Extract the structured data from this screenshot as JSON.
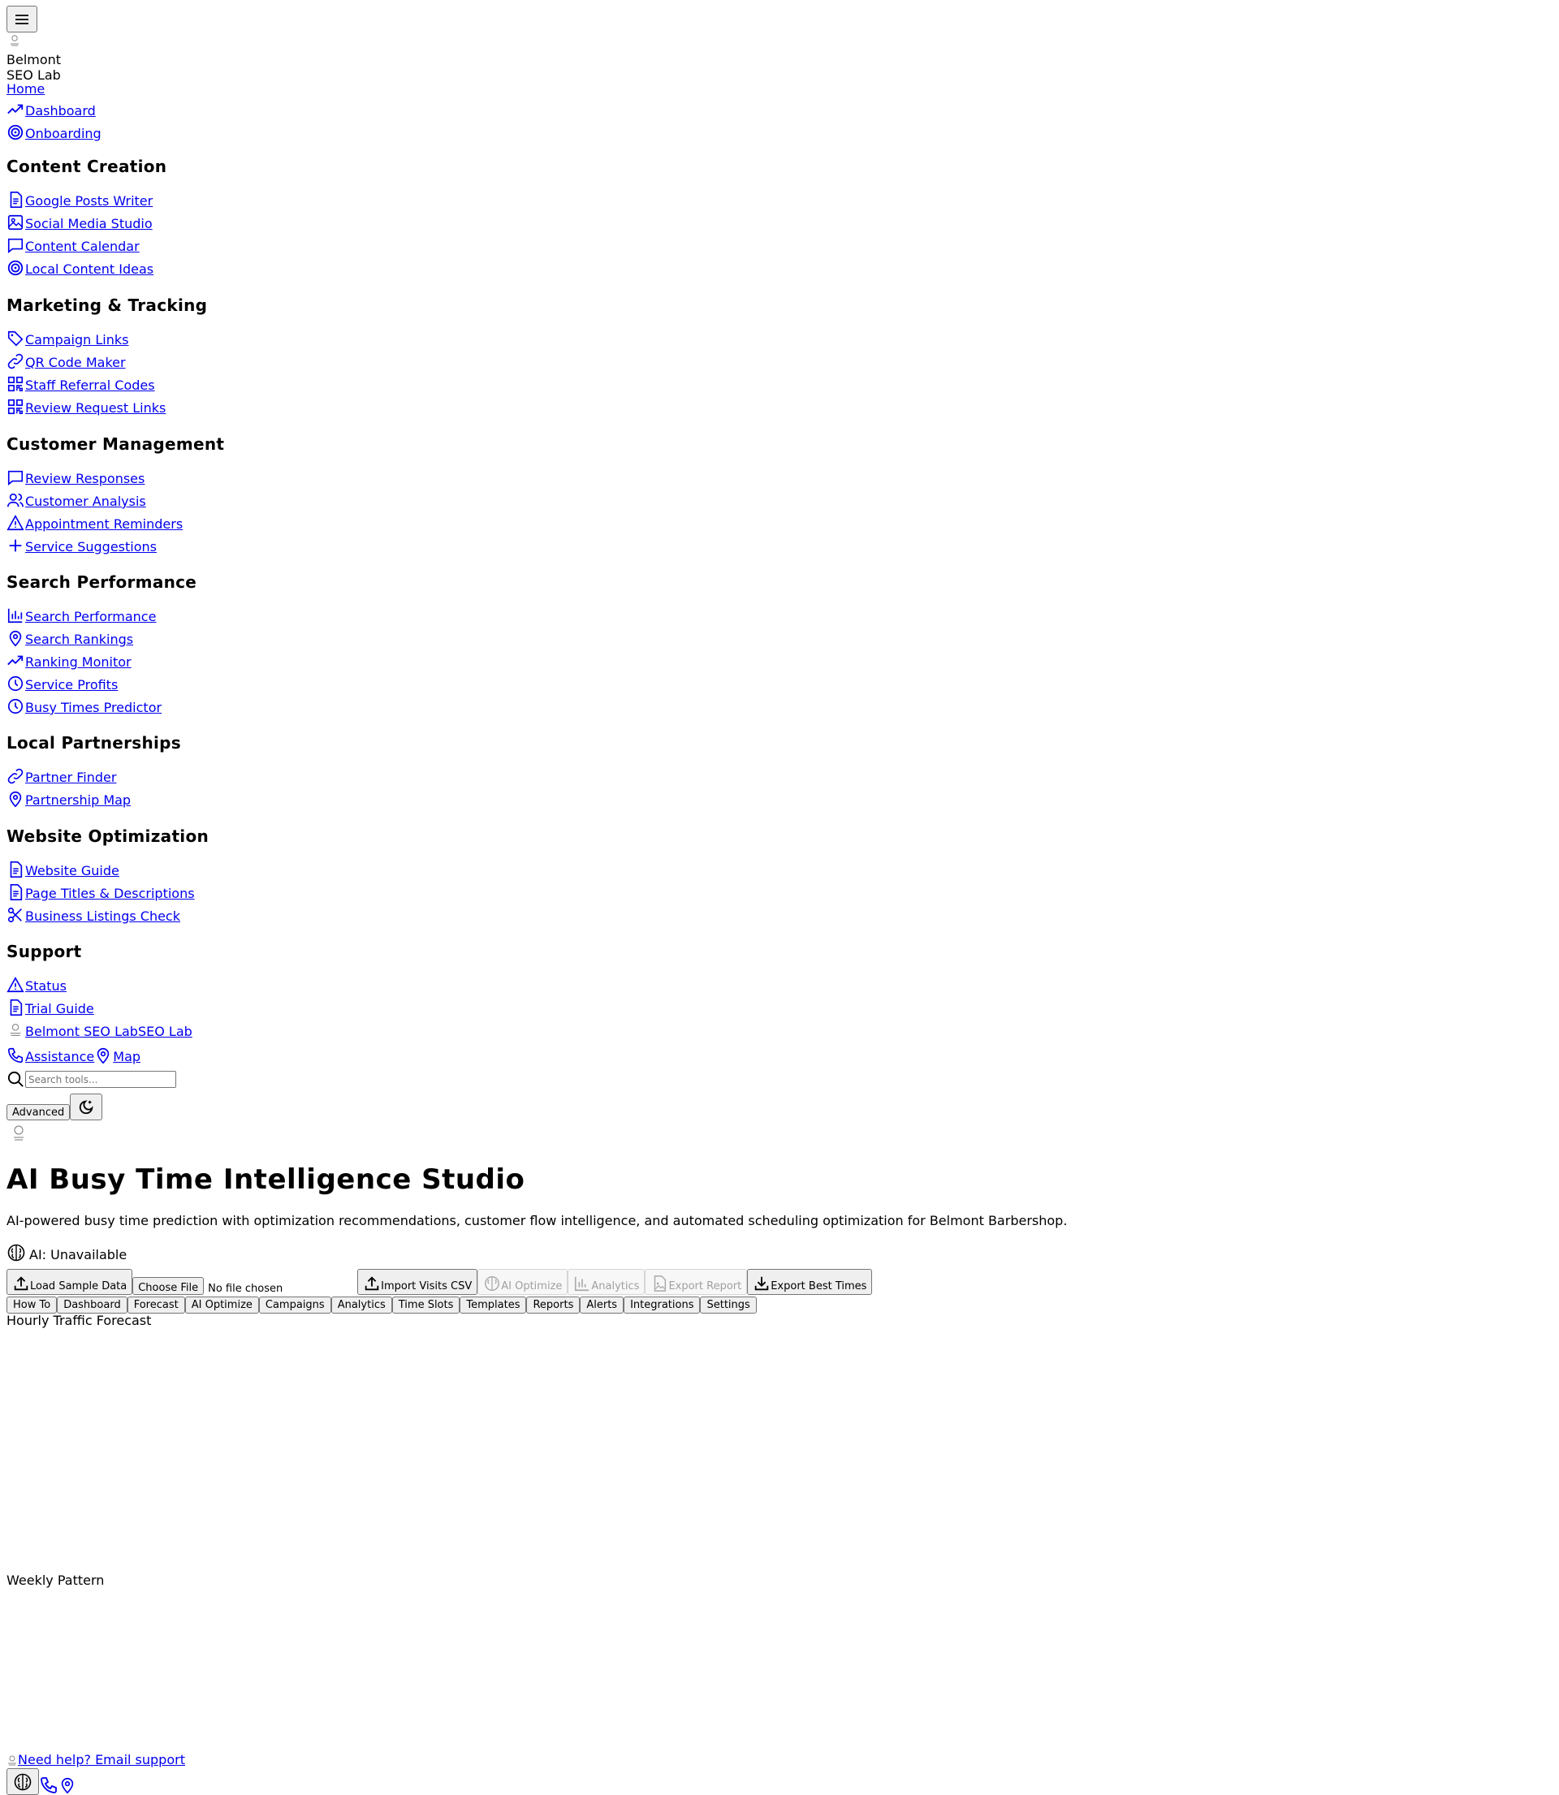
{
  "brand": {
    "name_line1": "Belmont",
    "name_line2": "SEO Lab"
  },
  "nav_top": [
    {
      "label": "Home",
      "icon": "none"
    },
    {
      "label": "Dashboard",
      "icon": "trending-up-icon"
    },
    {
      "label": "Onboarding",
      "icon": "target-icon"
    }
  ],
  "sections": [
    {
      "title": "Content Creation",
      "items": [
        {
          "label": "Google Posts Writer",
          "icon": "file-text-icon"
        },
        {
          "label": "Social Media Studio",
          "icon": "image-icon"
        },
        {
          "label": "Content Calendar",
          "icon": "message-square-icon"
        },
        {
          "label": "Local Content Ideas",
          "icon": "target-icon"
        }
      ]
    },
    {
      "title": "Marketing & Tracking",
      "items": [
        {
          "label": "Campaign Links",
          "icon": "tag-icon"
        },
        {
          "label": "QR Code Maker",
          "icon": "link-icon"
        },
        {
          "label": "Staff Referral Codes",
          "icon": "qr-code-icon"
        },
        {
          "label": "Review Request Links",
          "icon": "qr-code-icon"
        }
      ]
    },
    {
      "title": "Customer Management",
      "items": [
        {
          "label": "Review Responses",
          "icon": "message-square-icon"
        },
        {
          "label": "Customer Analysis",
          "icon": "users-icon"
        },
        {
          "label": "Appointment Reminders",
          "icon": "alert-triangle-icon"
        },
        {
          "label": "Service Suggestions",
          "icon": "plus-icon"
        }
      ]
    },
    {
      "title": "Search Performance",
      "items": [
        {
          "label": "Search Performance",
          "icon": "bar-chart-icon"
        },
        {
          "label": "Search Rankings",
          "icon": "map-pin-icon"
        },
        {
          "label": "Ranking Monitor",
          "icon": "trending-up-icon"
        },
        {
          "label": "Service Profits",
          "icon": "clock-icon"
        },
        {
          "label": "Busy Times Predictor",
          "icon": "clock-icon"
        }
      ]
    },
    {
      "title": "Local Partnerships",
      "items": [
        {
          "label": "Partner Finder",
          "icon": "link-icon"
        },
        {
          "label": "Partnership Map",
          "icon": "map-pin-icon"
        }
      ]
    },
    {
      "title": "Website Optimization",
      "items": [
        {
          "label": "Website Guide",
          "icon": "file-text-icon"
        },
        {
          "label": "Page Titles & Descriptions",
          "icon": "file-text-icon"
        },
        {
          "label": "Business Listings Check",
          "icon": "scissors-icon"
        }
      ]
    },
    {
      "title": "Support",
      "items": [
        {
          "label": "Status",
          "icon": "alert-triangle-icon"
        },
        {
          "label": "Trial Guide",
          "icon": "file-text-icon"
        },
        {
          "label": "Belmont SEO LabSEO Lab",
          "icon": "logo-icon"
        }
      ]
    }
  ],
  "support_extra": {
    "assistance": "Assistance",
    "map": "Map"
  },
  "search": {
    "placeholder": "Search tools..."
  },
  "advanced_label": "Advanced",
  "page": {
    "title": "AI Busy Time Intelligence Studio",
    "subtitle": "AI-powered busy time prediction with optimization recommendations, customer flow intelligence, and automated scheduling optimization for Belmont Barbershop.",
    "ai_status": "AI: Unavailable"
  },
  "toolbar": {
    "load_sample": "Load Sample Data",
    "choose_file": "Choose File",
    "no_file": "No file chosen",
    "import_csv": "Import Visits CSV",
    "ai_optimize": "AI Optimize",
    "analytics": "Analytics",
    "export_report": "Export Report",
    "export_best": "Export Best Times"
  },
  "tabs": [
    "How To",
    "Dashboard",
    "Forecast",
    "AI Optimize",
    "Campaigns",
    "Analytics",
    "Time Slots",
    "Templates",
    "Reports",
    "Alerts",
    "Integrations",
    "Settings"
  ],
  "charts": {
    "hourly": "Hourly Traffic Forecast",
    "weekly": "Weekly Pattern"
  },
  "footer": {
    "help": "Need help? Email support"
  },
  "colors": {
    "link": "#0000ee",
    "button_bg": "#efefef",
    "border": "#767676",
    "disabled": "#a0a0a0"
  }
}
